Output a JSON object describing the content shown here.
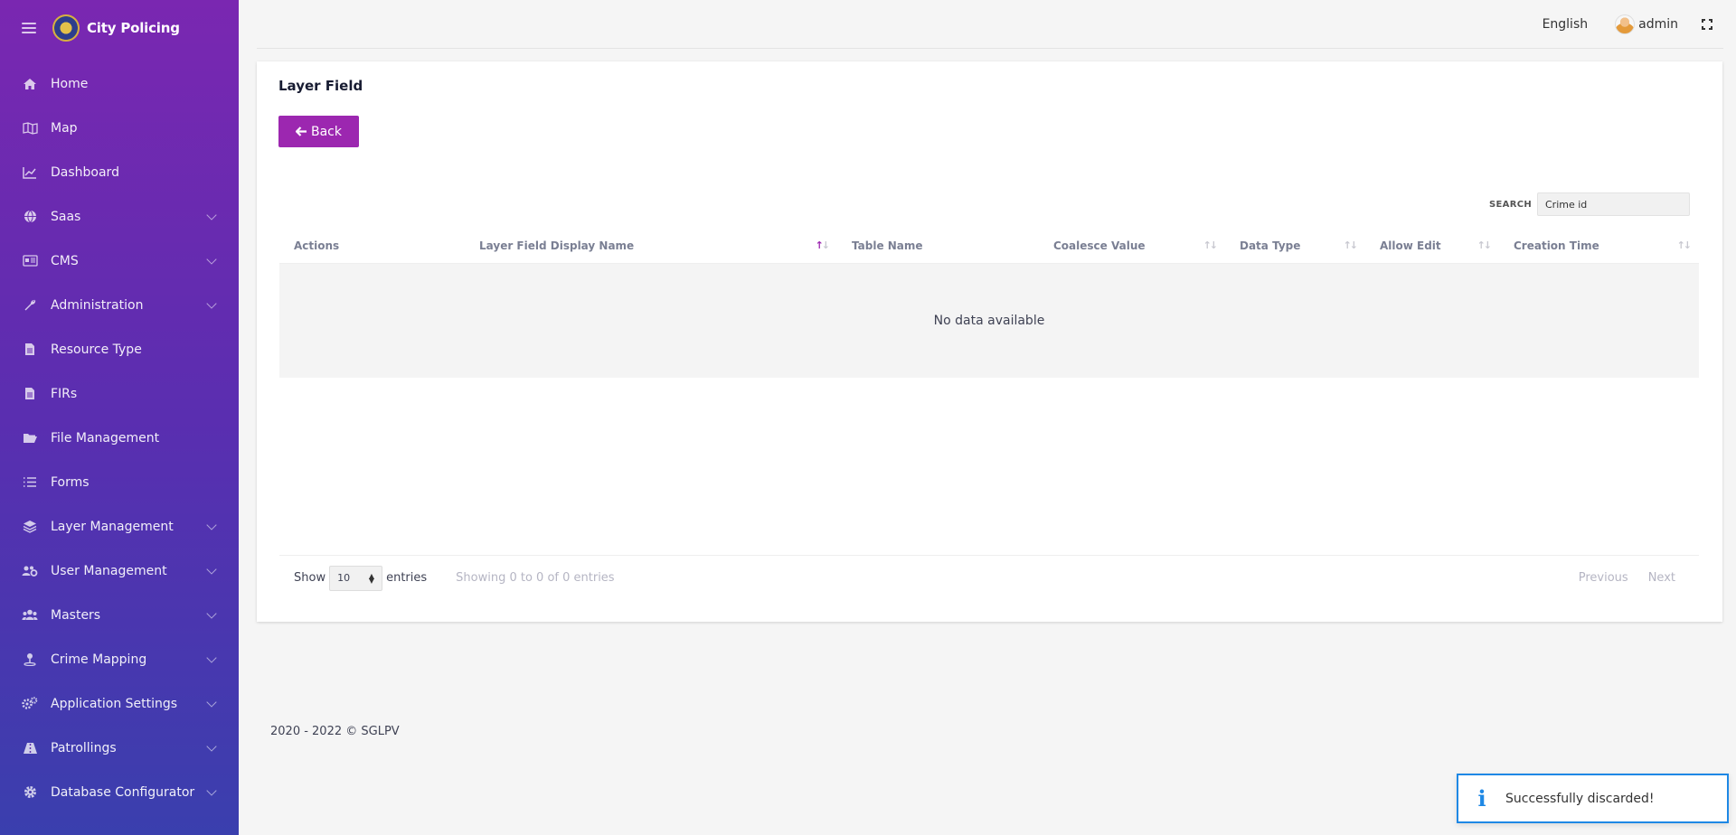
{
  "app": {
    "name": "City Policing"
  },
  "sidebar": {
    "items": [
      {
        "label": "Home",
        "icon": "home-icon",
        "has_submenu": false
      },
      {
        "label": "Map",
        "icon": "map-icon",
        "has_submenu": false
      },
      {
        "label": "Dashboard",
        "icon": "chart-line-icon",
        "has_submenu": false
      },
      {
        "label": "Saas",
        "icon": "globe-icon",
        "has_submenu": true
      },
      {
        "label": "CMS",
        "icon": "cms-icon",
        "has_submenu": true
      },
      {
        "label": "Administration",
        "icon": "wrench-icon",
        "has_submenu": true
      },
      {
        "label": "Resource Type",
        "icon": "file-icon",
        "has_submenu": false
      },
      {
        "label": "FIRs",
        "icon": "file-icon",
        "has_submenu": false
      },
      {
        "label": "File Management",
        "icon": "folder-open-icon",
        "has_submenu": false
      },
      {
        "label": "Forms",
        "icon": "list-icon",
        "has_submenu": false
      },
      {
        "label": "Layer Management",
        "icon": "layers-icon",
        "has_submenu": true
      },
      {
        "label": "User Management",
        "icon": "users-cog-icon",
        "has_submenu": true
      },
      {
        "label": "Masters",
        "icon": "users-icon",
        "has_submenu": true
      },
      {
        "label": "Crime Mapping",
        "icon": "map-pin-icon",
        "has_submenu": true
      },
      {
        "label": "Application Settings",
        "icon": "cogs-icon",
        "has_submenu": true
      },
      {
        "label": "Patrollings",
        "icon": "road-icon",
        "has_submenu": true
      },
      {
        "label": "Database Configurator",
        "icon": "gear-icon",
        "has_submenu": true
      }
    ]
  },
  "header": {
    "language": "English",
    "username": "admin"
  },
  "page": {
    "title": "Layer Field",
    "back_label": "Back",
    "search_label": "SEARCH",
    "search_value": "Crime id"
  },
  "table": {
    "columns": [
      {
        "label": "Actions",
        "sortable": false
      },
      {
        "label": "Layer Field Display Name",
        "sortable": true,
        "sorted": "asc"
      },
      {
        "label": "Table Name",
        "sortable": false
      },
      {
        "label": "Coalesce Value",
        "sortable": true
      },
      {
        "label": "Data Type",
        "sortable": true
      },
      {
        "label": "Allow Edit",
        "sortable": true
      },
      {
        "label": "Creation Time",
        "sortable": true
      }
    ],
    "rows": [],
    "empty_text": "No data available",
    "show_label": "Show",
    "page_size": "10",
    "entries_label": "entries",
    "info": "Showing 0 to 0 of 0 entries",
    "prev_label": "Previous",
    "next_label": "Next"
  },
  "footer": {
    "copyright": "2020 - 2022 © SGLPV"
  },
  "toast": {
    "message": "Successfully discarded!",
    "type": "info"
  },
  "colors": {
    "primary": "#9c27b0",
    "sidebar_top": "#7a27b1",
    "sidebar_bottom": "#3a3fae",
    "toast_border": "#1e88e5"
  }
}
